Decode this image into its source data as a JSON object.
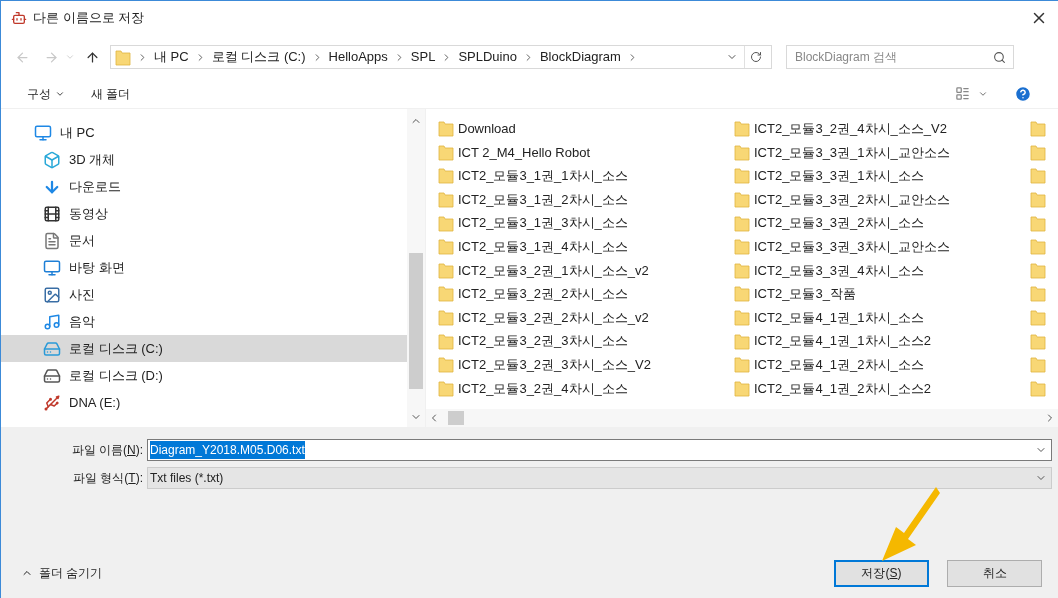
{
  "window": {
    "title": "다른 이름으로 저장"
  },
  "address": {
    "back_disabled": true,
    "forward_disabled": true,
    "path": [
      "내 PC",
      "로컬 디스크 (C:)",
      "HelloApps",
      "SPL",
      "SPLDuino",
      "BlockDiagram"
    ]
  },
  "search": {
    "placeholder": "BlockDiagram 검색"
  },
  "toolbar": {
    "organize": "구성",
    "new_folder": "새 폴더"
  },
  "sidebar": {
    "items": [
      {
        "label": "내 PC",
        "kind": "pc",
        "selected": false,
        "children": [
          {
            "label": "3D 개체",
            "kind": "cube",
            "selected": false
          },
          {
            "label": "다운로드",
            "kind": "download",
            "selected": false
          },
          {
            "label": "동영상",
            "kind": "video",
            "selected": false
          },
          {
            "label": "문서",
            "kind": "document",
            "selected": false
          },
          {
            "label": "바탕 화면",
            "kind": "desktop",
            "selected": false
          },
          {
            "label": "사진",
            "kind": "picture",
            "selected": false
          },
          {
            "label": "음악",
            "kind": "music",
            "selected": false
          },
          {
            "label": "로컬 디스크 (C:)",
            "kind": "system-drive",
            "selected": true
          },
          {
            "label": "로컬 디스크 (D:)",
            "kind": "drive",
            "selected": false
          },
          {
            "label": "DNA (E:)",
            "kind": "removable",
            "selected": false
          }
        ]
      }
    ]
  },
  "folders": {
    "columns": [
      [
        "Download",
        "ICT 2_M4_Hello Robot",
        "ICT2_모듈3_1권_1차시_소스",
        "ICT2_모듈3_1권_2차시_소스",
        "ICT2_모듈3_1권_3차시_소스",
        "ICT2_모듈3_1권_4차시_소스",
        "ICT2_모듈3_2권_1차시_소스_v2",
        "ICT2_모듈3_2권_2차시_소스",
        "ICT2_모듈3_2권_2차시_소스_v2",
        "ICT2_모듈3_2권_3차시_소스",
        "ICT2_모듈3_2권_3차시_소스_V2",
        "ICT2_모듈3_2권_4차시_소스"
      ],
      [
        "ICT2_모듈3_2권_4차시_소스_V2",
        "ICT2_모듈3_3권_1차시_교안소스",
        "ICT2_모듈3_3권_1차시_소스",
        "ICT2_모듈3_3권_2차시_교안소스",
        "ICT2_모듈3_3권_2차시_소스",
        "ICT2_모듈3_3권_3차시_교안소스",
        "ICT2_모듈3_3권_4차시_소스",
        "ICT2_모듈3_작품",
        "ICT2_모듈4_1권_1차시_소스",
        "ICT2_모듈4_1권_1차시_소스2",
        "ICT2_모듈4_1권_2차시_소스",
        "ICT2_모듈4_1권_2차시_소스2"
      ]
    ]
  },
  "file_name": {
    "label_before": "파일 이름(",
    "hotkey": "N",
    "label_after": "):",
    "value": "Diagram_Y2018.M05.D06.txt",
    "selected": true
  },
  "file_type": {
    "label_before": "파일 형식(",
    "hotkey": "T",
    "label_after": "):",
    "value": "Txt files (*.txt)"
  },
  "hide_folders": "폴더 숨기기",
  "buttons": [
    {
      "before": "저장(",
      "hotkey": "S",
      "after": ")",
      "default": true
    },
    {
      "before": "취소",
      "default": false
    }
  ]
}
